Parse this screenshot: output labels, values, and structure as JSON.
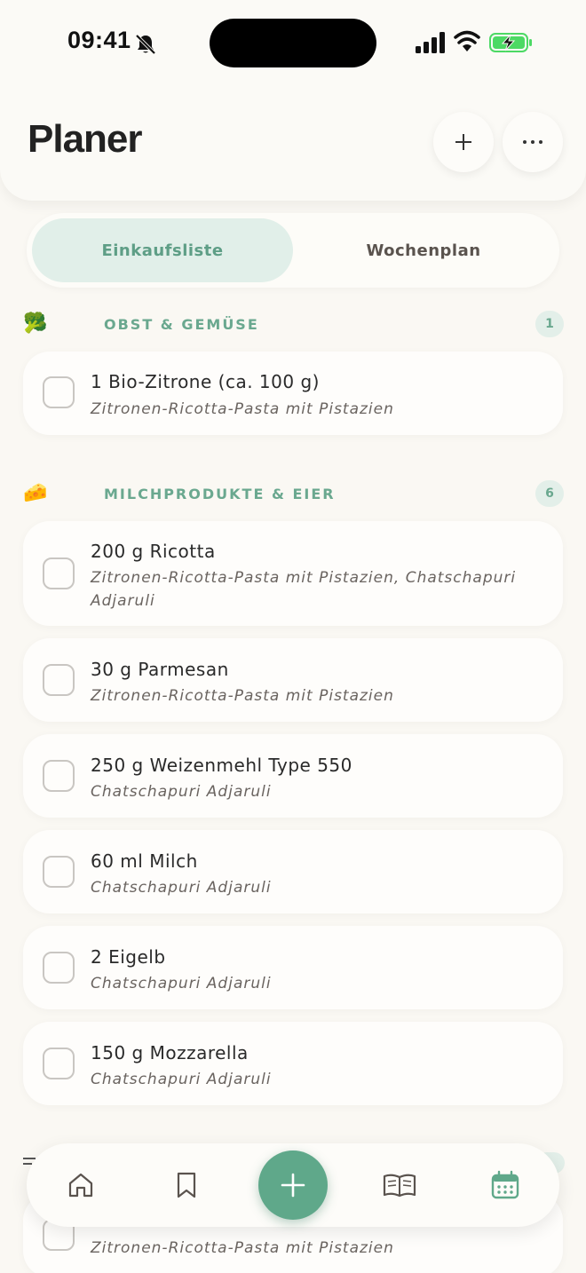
{
  "status_bar": {
    "time": "09:41"
  },
  "header": {
    "title": "Planer"
  },
  "tabs": [
    {
      "label": "Einkaufsliste",
      "active": true
    },
    {
      "label": "Wochenplan",
      "active": false
    }
  ],
  "sections": [
    {
      "emoji": "🥦",
      "title": "OBST & GEMÜSE",
      "count": "1",
      "items": [
        {
          "name": "1 Bio-Zitrone (ca. 100 g)",
          "recipe": "Zitronen-Ricotta-Pasta mit Pistazien"
        }
      ]
    },
    {
      "emoji": "🧀",
      "title": "MILCHPRODUKTE & EIER",
      "count": "6",
      "items": [
        {
          "name": "200 g Ricotta",
          "recipe": "Zitronen-Ricotta-Pasta mit Pistazien, Chatschapuri Adjaruli"
        },
        {
          "name": "30 g Parmesan",
          "recipe": "Zitronen-Ricotta-Pasta mit Pistazien"
        },
        {
          "name": "250 g Weizenmehl Type 550",
          "recipe": "Chatschapuri Adjaruli"
        },
        {
          "name": "60 ml Milch",
          "recipe": "Chatschapuri Adjaruli"
        },
        {
          "name": "2 Eigelb",
          "recipe": "Chatschapuri Adjaruli"
        },
        {
          "name": "150 g Mozzarella",
          "recipe": "Chatschapuri Adjaruli"
        }
      ]
    },
    {
      "items": [
        {
          "name": "",
          "recipe": "Zitronen-Ricotta-Pasta mit Pistazien"
        }
      ]
    }
  ],
  "colors": {
    "accent": "#5fa88a",
    "accent_light": "#e1efe9",
    "background": "#faf8f3"
  }
}
